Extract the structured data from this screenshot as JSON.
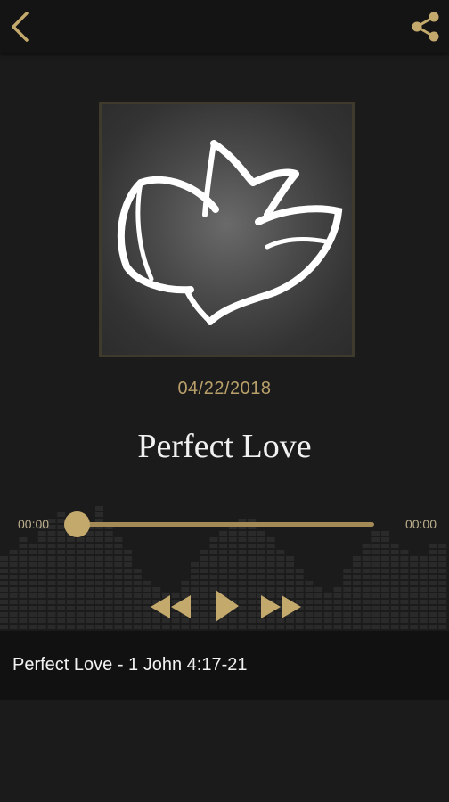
{
  "header": {
    "back_icon": "chevron-left-icon",
    "share_icon": "share-icon",
    "accent_color": "#c4a96d"
  },
  "episode": {
    "artwork_icon": "dove-logo-icon",
    "date": "04/22/2018",
    "title": "Perfect Love"
  },
  "player": {
    "elapsed": "00:00",
    "duration": "00:00",
    "progress": 0,
    "rewind_icon": "rewind-icon",
    "play_icon": "play-icon",
    "forward_icon": "fast-forward-icon"
  },
  "now_playing": {
    "label": "Perfect Love - 1 John 4:17-21"
  }
}
